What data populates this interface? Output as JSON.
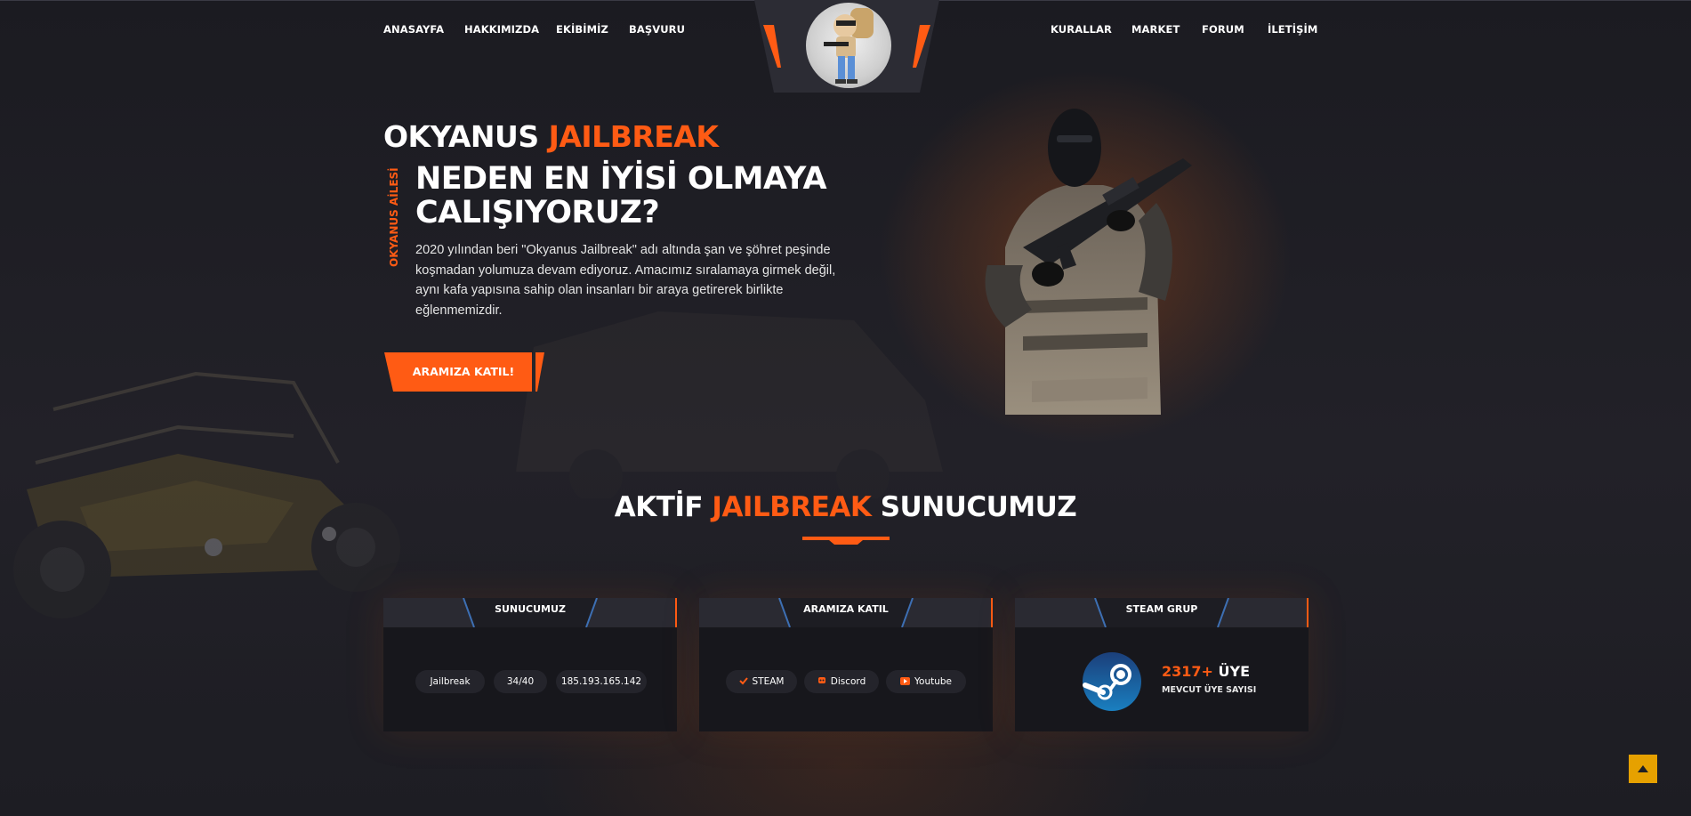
{
  "nav": {
    "left": [
      "ANASAYFA",
      "HAKKIMIZDA",
      "EKİBİMİZ",
      "BAŞVURU"
    ],
    "right": [
      "KURALLAR",
      "MARKET",
      "FORUM",
      "İLETİŞİM"
    ]
  },
  "hero": {
    "brand_white": "OKYANUS ",
    "brand_orange": "JAILBREAK",
    "side_tag": "OKYANUS AİLESİ",
    "headline_line1": "NEDEN EN İYİSİ OLMAYA",
    "headline_line2": "CALIŞIYORUZ?",
    "description": "2020 yılından beri \"Okyanus Jailbreak\" adı altında şan ve şöhret peşinde koşmadan yolumuza devam ediyoruz. Amacımız sıralamaya girmek değil, aynı kafa yapısına sahip olan insanları bir araya getirerek birlikte eğlenmemizdir.",
    "cta_label": "ARAMIZA KATIL!"
  },
  "section": {
    "title_part1": "AKTİF ",
    "title_part2": "JAILBREAK",
    "title_part3": " SUNUCUMUZ"
  },
  "cards": {
    "server": {
      "title": "SUNUCUMUZ",
      "mode": "Jailbreak",
      "players": "34/40",
      "ip": "185.193.165.142"
    },
    "join": {
      "title": "ARAMIZA KATIL",
      "links": [
        {
          "label": "STEAM",
          "icon": "steam-check-icon"
        },
        {
          "label": "Discord",
          "icon": "discord-icon"
        },
        {
          "label": "Youtube",
          "icon": "youtube-icon"
        }
      ]
    },
    "steam": {
      "title": "STEAM GRUP",
      "count_number": "2317+",
      "count_label": " ÜYE",
      "subtitle": "MEVCUT ÜYE SAYISI"
    }
  },
  "colors": {
    "accent": "#ff5b14",
    "background": "#1f1f25",
    "card": "#17171c",
    "scroll_button": "#e6a100"
  }
}
